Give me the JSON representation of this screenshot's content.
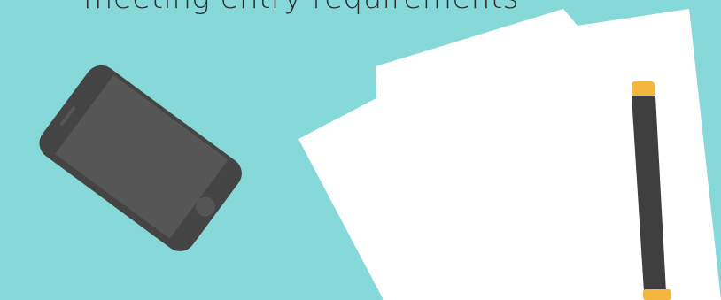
{
  "headline": "meeting entry requirements",
  "colors": {
    "background": "#87d8d8",
    "phone_body": "#444444",
    "phone_screen": "#565656",
    "paper": "#ffffff",
    "pen_body": "#3f3f3f",
    "pen_cap": "#f4b63e"
  },
  "icons": {
    "phone": "smartphone-icon",
    "paper": "paper-sheets-icon",
    "pen": "pen-icon"
  }
}
